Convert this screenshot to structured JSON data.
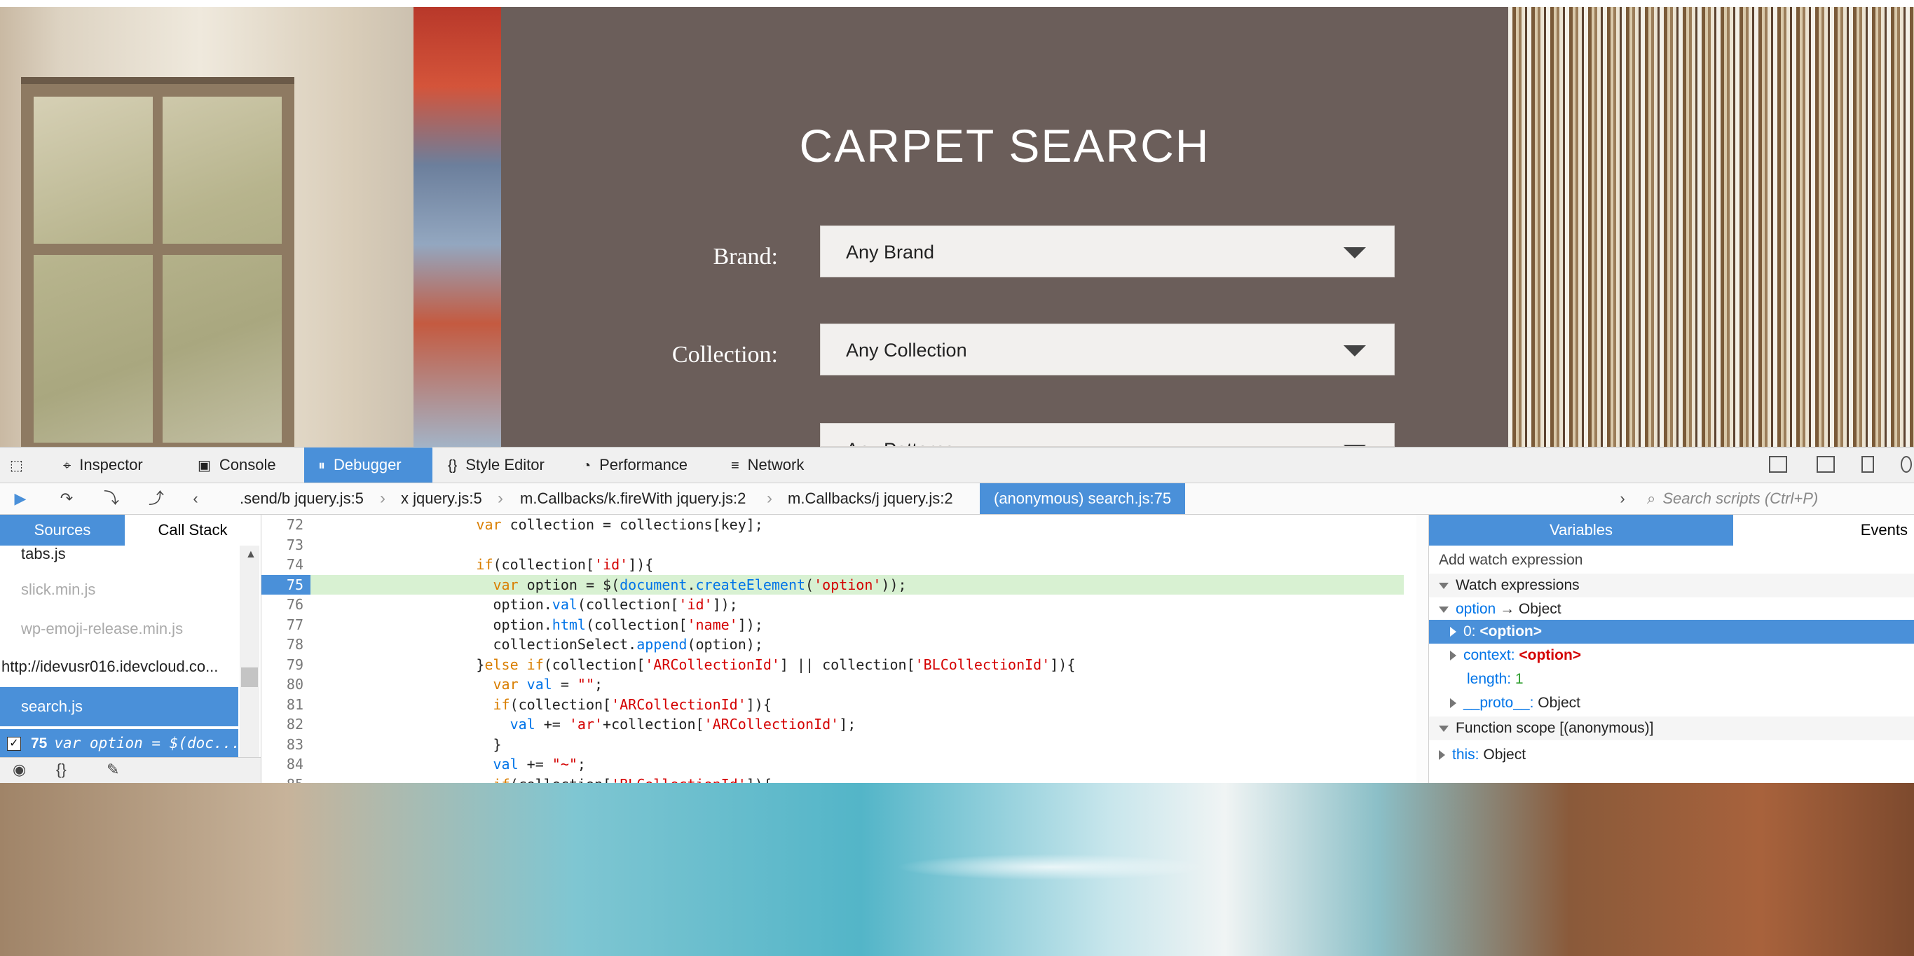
{
  "site": {
    "title": "CARPET SEARCH",
    "brand_label": "Brand:",
    "brand_value": "Any Brand",
    "collection_label": "Collection:",
    "collection_value": "Any Collection",
    "pattern_value": "Any Patterns"
  },
  "toolbar": {
    "tabs": [
      {
        "label": "Inspector",
        "icon": "inspector-icon"
      },
      {
        "label": "Console",
        "icon": "console-icon"
      },
      {
        "label": "Debugger",
        "icon": "debugger-icon"
      },
      {
        "label": "Style Editor",
        "icon": "style-editor-icon"
      },
      {
        "label": "Performance",
        "icon": "performance-icon"
      },
      {
        "label": "Network",
        "icon": "network-icon"
      }
    ],
    "active_tab": "Debugger",
    "accent": "#4a90d9"
  },
  "debugbar": {
    "breadcrumbs": [
      ".send/b jquery.js:5",
      "x jquery.js:5",
      "m.Callbacks/k.fireWith jquery.js:2",
      "m.Callbacks/j jquery.js:2",
      "(anonymous) search.js:75"
    ],
    "search_placeholder": "Search scripts (Ctrl+P)"
  },
  "sources": {
    "tabs": [
      "Sources",
      "Call Stack"
    ],
    "items": [
      {
        "label": "tabs.js"
      },
      {
        "label": "slick.min.js"
      },
      {
        "label": "wp-emoji-release.min.js"
      },
      {
        "label": "http://idevusr016.idevcloud.co..."
      },
      {
        "label": "search.js"
      }
    ],
    "breakpoint": {
      "line": "75",
      "text": "var option = $(doc..."
    }
  },
  "editor": {
    "current_line": 75,
    "lines": [
      {
        "n": "72",
        "text": "          var collection = collections[key];"
      },
      {
        "n": "73",
        "text": ""
      },
      {
        "n": "74",
        "text": "          if(collection['id']){"
      },
      {
        "n": "75",
        "text": "            var option = $(document.createElement('option'));"
      },
      {
        "n": "76",
        "text": "            option.val(collection['id']);"
      },
      {
        "n": "77",
        "text": "            option.html(collection['name']);"
      },
      {
        "n": "78",
        "text": "            collectionSelect.append(option);"
      },
      {
        "n": "79",
        "text": "          }else if(collection['ARCollectionId'] || collection['BLCollectionId']){"
      },
      {
        "n": "80",
        "text": "            var val = \"\";"
      },
      {
        "n": "81",
        "text": "            if(collection['ARCollectionId']){"
      },
      {
        "n": "82",
        "text": "              val += 'ar'+collection['ARCollectionId'];"
      },
      {
        "n": "83",
        "text": "            }"
      },
      {
        "n": "84",
        "text": "            val += \"~\";"
      },
      {
        "n": "85",
        "text": "            if(collection['BLCollectionId']){"
      }
    ]
  },
  "variables": {
    "tabs": [
      "Variables",
      "Events"
    ],
    "add_watch": "Add watch expression",
    "watch_header": "Watch expressions",
    "option_name": "option",
    "option_arrow": "→",
    "option_type": "Object",
    "child0_key": "0:",
    "child0_val": "<option>",
    "context_key": "context:",
    "context_val": "<option>",
    "length_key": "length:",
    "length_val": "1",
    "proto_key": "__proto__:",
    "proto_val": "Object",
    "function_scope": "Function scope [(anonymous)]",
    "this_key": "this:",
    "this_val": "Object"
  }
}
